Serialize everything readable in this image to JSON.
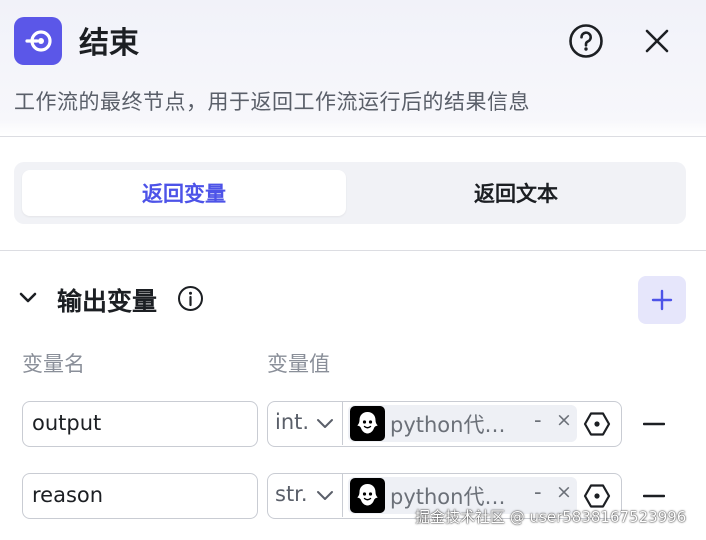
{
  "header": {
    "title": "结束",
    "description": "工作流的最终节点，用于返回工作流运行后的结果信息",
    "icon": "end-node-icon",
    "accent": "#5b57e8"
  },
  "tabs": [
    {
      "label": "返回变量",
      "active": true
    },
    {
      "label": "返回文本",
      "active": false
    }
  ],
  "section": {
    "title": "输出变量",
    "columns": {
      "name": "变量名",
      "value": "变量值"
    }
  },
  "rows": [
    {
      "name": "output",
      "type": "int.",
      "ref_label": "python代…",
      "dash": "-",
      "remove": "×"
    },
    {
      "name": "reason",
      "type": "str.",
      "ref_label": "python代…",
      "dash": "-",
      "remove": "×"
    }
  ],
  "watermark": "掘金技术社区 @ user5838167523996"
}
